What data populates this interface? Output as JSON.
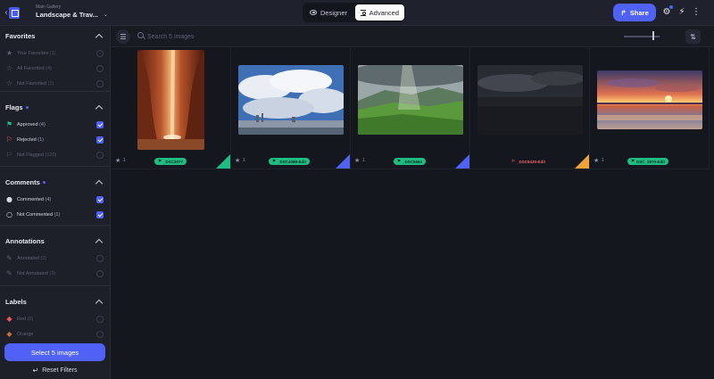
{
  "header": {
    "gallery_sub": "Main Gallery",
    "gallery_title": "Landscape & Trav...",
    "designer_label": "Designer",
    "advanced_label": "Advanced",
    "share_label": "Share"
  },
  "sidebar": {
    "favorites": {
      "title": "Favorites",
      "items": [
        {
          "label": "Your Favorites",
          "count": "(1)",
          "icon": "star-icon",
          "checked": false
        },
        {
          "label": "All Favorited",
          "count": "(4)",
          "icon": "star-outline-icon",
          "checked": false
        },
        {
          "label": "Not Favorited",
          "count": "(1)",
          "icon": "star-outline-icon",
          "checked": false
        }
      ]
    },
    "flags": {
      "title": "Flags",
      "items": [
        {
          "label": "Approved",
          "count": "(4)",
          "icon": "flag-approved-icon",
          "checked": true
        },
        {
          "label": "Rejected",
          "count": "(1)",
          "icon": "flag-rejected-icon",
          "checked": true
        },
        {
          "label": "Not Flagged",
          "count": "(120)",
          "icon": "flag-outline-icon",
          "checked": false
        }
      ]
    },
    "comments": {
      "title": "Comments",
      "items": [
        {
          "label": "Commented",
          "count": "(4)",
          "icon": "comment-icon",
          "checked": true
        },
        {
          "label": "Not Commented",
          "count": "(1)",
          "icon": "comment-outline-icon",
          "checked": true
        }
      ]
    },
    "annotations": {
      "title": "Annotations",
      "items": [
        {
          "label": "Annotated",
          "count": "(2)",
          "icon": "annotation-icon",
          "checked": false
        },
        {
          "label": "Not Annotated",
          "count": "(3)",
          "icon": "annotation-off-icon",
          "checked": false
        }
      ]
    },
    "labels": {
      "title": "Labels",
      "items": [
        {
          "label": "Red",
          "count": "(0)",
          "icon": "tag-red-icon",
          "checked": false
        },
        {
          "label": "Orange",
          "count": "",
          "icon": "tag-orange-icon",
          "checked": false
        }
      ]
    },
    "select_button": "Select 5 images",
    "reset_button": "Reset Filters"
  },
  "toolbar": {
    "search_placeholder": "Search 5 images"
  },
  "images": [
    {
      "name": "_DSC2077",
      "favorites": "1",
      "status": "approved",
      "corner_color": "#1fbd84"
    },
    {
      "name": "_DSC4089-Edit",
      "favorites": "1",
      "status": "approved",
      "corner_color": "#4f62f5"
    },
    {
      "name": "_DSC5664",
      "favorites": "1",
      "status": "approved",
      "corner_color": "#4f62f5"
    },
    {
      "name": "_DSC9430-Edit",
      "favorites": "",
      "status": "rejected",
      "corner_color": "#f0a23a"
    },
    {
      "name": "DSC_2970-Edit",
      "favorites": "1",
      "status": "approved",
      "corner_color": ""
    }
  ],
  "colors": {
    "accent": "#4f62f5",
    "approved": "#1fbd84",
    "rejected": "#f06464"
  }
}
